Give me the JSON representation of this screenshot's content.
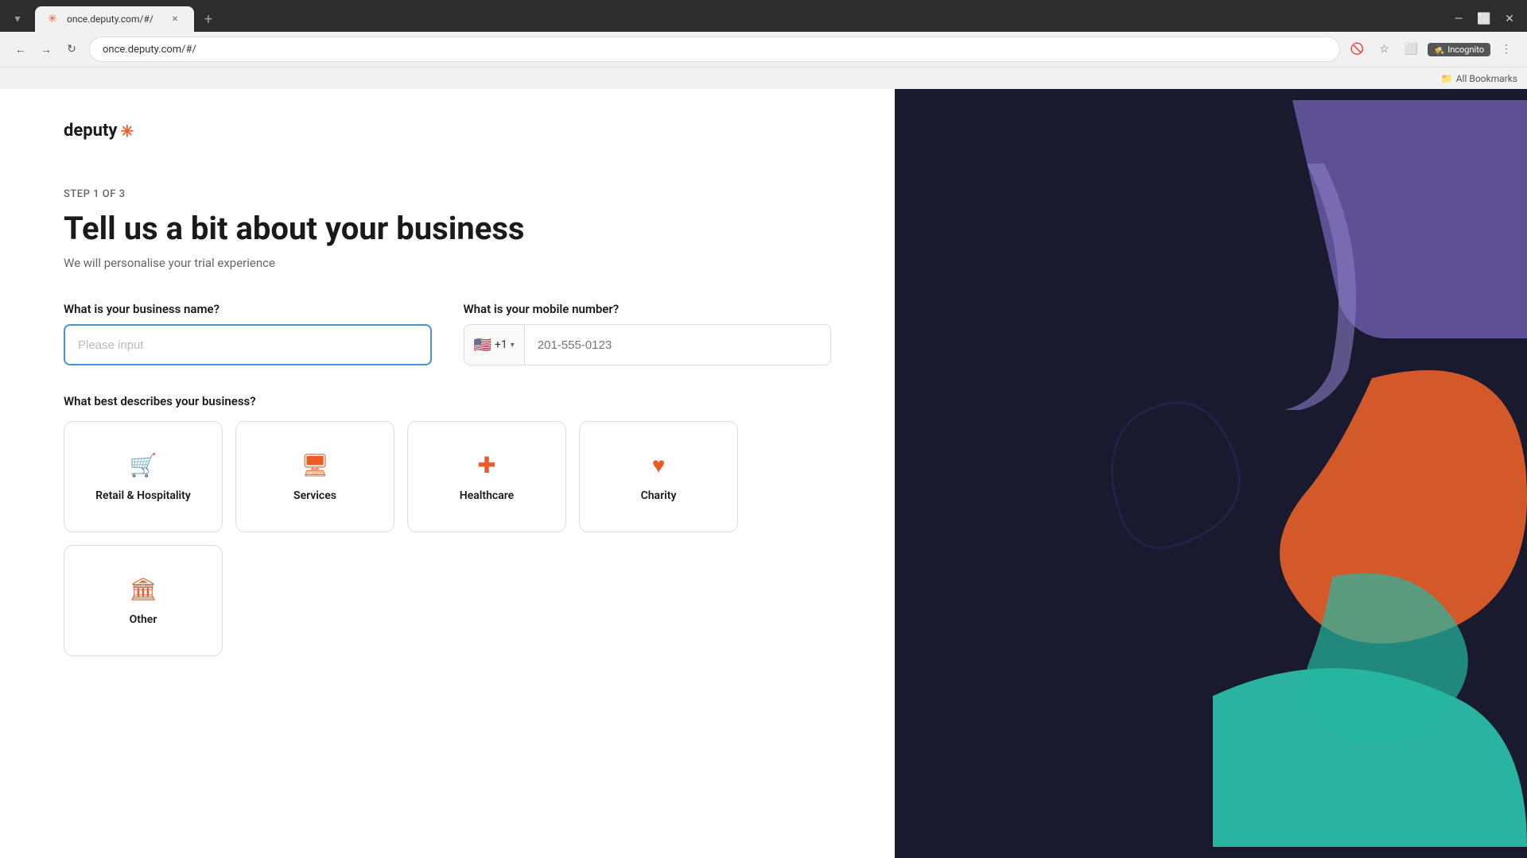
{
  "browser": {
    "url": "once.deputy.com/#/",
    "tab_title": "once.deputy.com/#/",
    "incognito_label": "Incognito",
    "bookmarks_label": "All Bookmarks"
  },
  "logo": {
    "text": "deputy",
    "star": "✳"
  },
  "step": {
    "label": "STEP 1 OF 3",
    "title": "Tell us a bit about your business",
    "subtitle": "We will personalise your trial experience"
  },
  "form": {
    "business_name_label": "What is your business name?",
    "business_name_placeholder": "Please input",
    "mobile_label": "What is your mobile number?",
    "mobile_placeholder": "201-555-0123",
    "mobile_country_code": "+1",
    "mobile_flag": "🇺🇸",
    "business_type_label": "What best describes your business?",
    "business_types": [
      {
        "id": "retail",
        "label": "Retail & Hospitality",
        "icon": "🛒"
      },
      {
        "id": "services",
        "label": "Services",
        "icon": "🖥"
      },
      {
        "id": "healthcare",
        "label": "Healthcare",
        "icon": "➕"
      },
      {
        "id": "charity",
        "label": "Charity",
        "icon": "♥"
      },
      {
        "id": "other",
        "label": "Other",
        "icon": "🏛"
      }
    ]
  }
}
